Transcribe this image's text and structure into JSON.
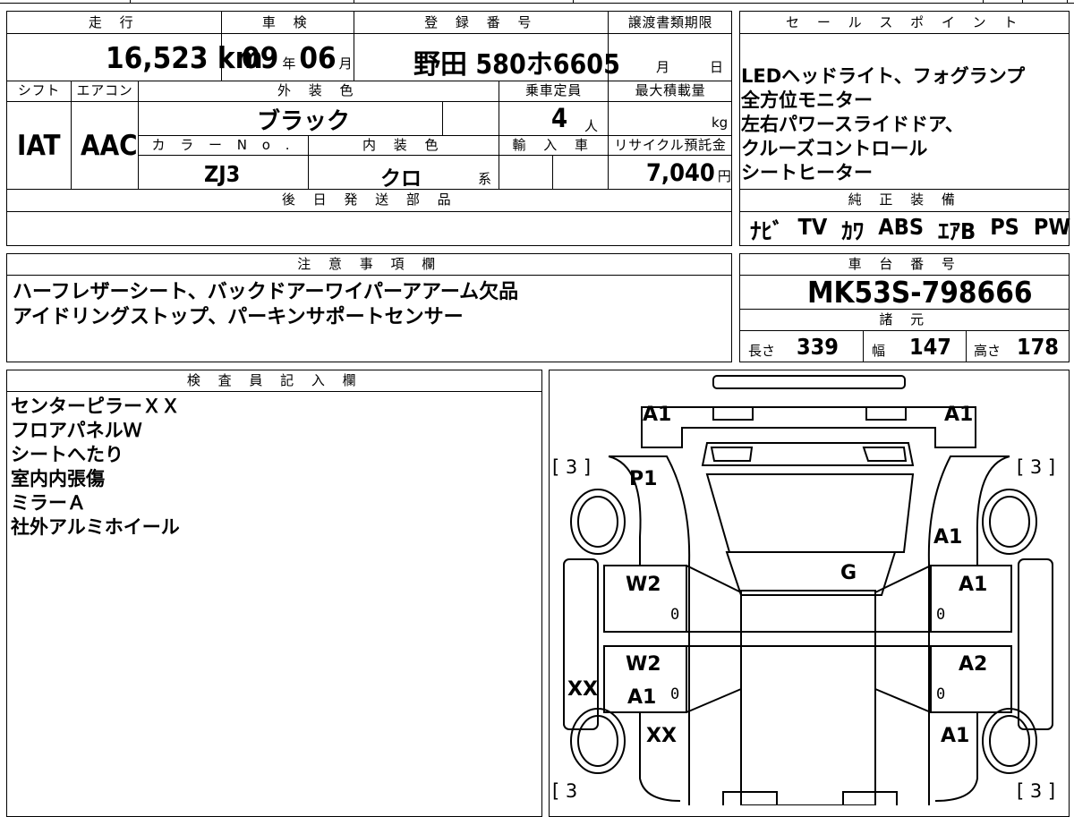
{
  "vehicle_info": {
    "mileage_header": "走 行",
    "mileage_value": "16,523",
    "mileage_unit": "km",
    "shaken_header": "車 検",
    "shaken_year": "09",
    "shaken_year_unit": "年",
    "shaken_month": "06",
    "shaken_month_unit": "月",
    "reg_header": "登 録 番 号",
    "reg_value": "野田 580ホ6605",
    "transfer_header": "譲渡書類期限",
    "transfer_month_unit": "月",
    "transfer_day_unit": "日",
    "shift_header": "シフト",
    "shift_value": "IAT",
    "ac_header": "エアコン",
    "ac_value": "AAC",
    "ext_color_header": "外 装 色",
    "ext_color_value": "ブラック",
    "capacity_header": "乗車定員",
    "capacity_value": "4",
    "capacity_unit": "人",
    "maxload_header": "最大積載量",
    "maxload_unit": "kg",
    "colorno_header": "カ ラ ー N o .",
    "colorno_value": "ZJ3",
    "int_color_header": "内 装 色",
    "int_color_value": "クロ",
    "int_color_unit": "系",
    "import_header": "輸 入 車",
    "recycle_header": "リサイクル預託金",
    "recycle_value": "7,040",
    "recycle_unit": "円",
    "later_parts_header": "後 日 発 送 部 品"
  },
  "sales_points": {
    "header": "セ ー ル ス ポ イ ン ト",
    "lines": [
      "LEDヘッドライト、フォグランプ",
      "全方位モニター",
      "左右パワースライドドア、",
      "クルーズコントロール",
      "シートヒーター"
    ]
  },
  "equipment": {
    "header": "純 正 装 備",
    "items": [
      "ﾅﾋﾞ",
      "TV",
      "ｶﾜ",
      "ABS",
      "ｴｱB",
      "PS",
      "PW"
    ]
  },
  "notes": {
    "header": "注 意 事 項 欄",
    "lines": [
      "ハーフレザーシート、バックドアーワイパーアアーム欠品",
      "アイドリングストップ、パーキンサポートセンサー"
    ]
  },
  "chassis": {
    "header": "車 台 番 号",
    "value": "MK53S-798666",
    "specs_header": "諸 元",
    "length_label": "長さ",
    "length_value": "339",
    "width_label": "幅",
    "width_value": "147",
    "height_label": "高さ",
    "height_value": "178"
  },
  "inspector": {
    "header": "検 査 員 記 入 欄",
    "lines": [
      "センターピラーＸＸ",
      "フロアパネルＷ",
      "シートへたり",
      "室内内張傷",
      "ミラーＡ",
      "社外アルミホイール"
    ]
  },
  "diagram": {
    "marks": {
      "front_left": "A1",
      "front_right": "A1",
      "p1": "P1",
      "right_fender": "A1",
      "roof": "G",
      "left_front_door": "W2",
      "right_front_door": "A1",
      "left_rear_door": "W2",
      "left_rear_door_2": "A1",
      "right_rear_door": "A2",
      "left_pillar": "XX",
      "left_rear_quarter": "XX",
      "right_rear_quarter": "A1"
    },
    "tire_tl": "[ 3 ]",
    "tire_tr": "[ 3 ]",
    "tire_bl": "[ 3",
    "tire_br": "[ 3 ]",
    "zero": "0"
  }
}
